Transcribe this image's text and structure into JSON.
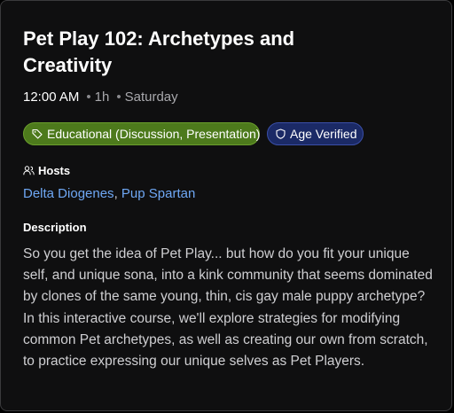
{
  "event": {
    "title": "Pet Play 102: Archetypes and Creativity",
    "time": "12:00 AM",
    "duration": "1h",
    "day": "Saturday",
    "separator": "•"
  },
  "tags": [
    {
      "label": "Educational (Discussion, Presentation)",
      "icon": "tag-icon",
      "color": "#4d7a1c"
    },
    {
      "label": "Age Verified",
      "icon": "shield-icon",
      "color": "#1b2a66"
    }
  ],
  "hosts": {
    "label": "Hosts",
    "icon": "people-icon",
    "list": [
      "Delta Diogenes",
      "Pup Spartan"
    ],
    "joiner": ", "
  },
  "description": {
    "label": "Description",
    "text": "So you get the idea of Pet Play... but how do you fit your unique self, and unique sona, into a kink community that seems dominated by clones of the same young, thin, cis gay male puppy archetype? In this interactive course, we'll explore strategies for modifying common Pet archetypes, as well as creating our own from scratch, to practice expressing our unique selves as Pet Players."
  },
  "colors": {
    "background": "#0f0f10",
    "link": "#6fa8f5",
    "text": "#cfcfd2"
  }
}
